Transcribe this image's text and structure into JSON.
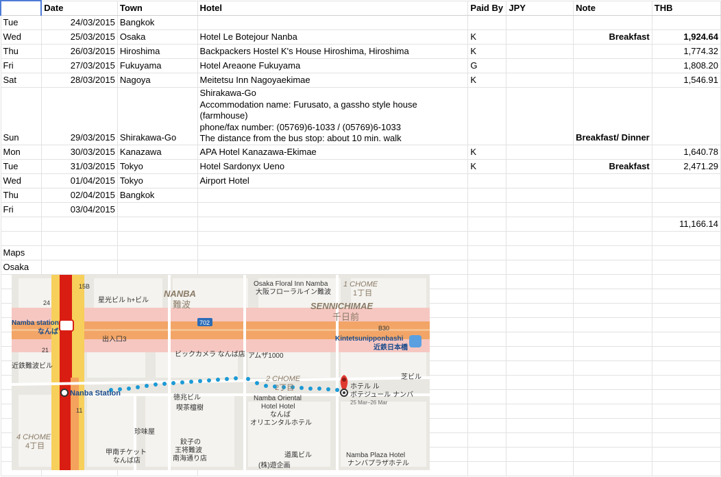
{
  "headers": [
    "",
    "Date",
    "Town",
    "Hotel",
    "Paid By",
    "JPY",
    "Note",
    "THB"
  ],
  "rows": [
    [
      "Tue",
      "24/03/2015",
      "Bangkok",
      "",
      "",
      "",
      "",
      ""
    ],
    [
      "Wed",
      "25/03/2015",
      "Osaka",
      "Hotel Le Botejour Nanba",
      "K",
      "",
      "Breakfast",
      "1,924.64"
    ],
    [
      "Thu",
      "26/03/2015",
      "Hiroshima",
      "Backpackers Hostel K's House Hiroshima, Hiroshima",
      "K",
      "",
      "",
      "1,774.32"
    ],
    [
      "Fri",
      "27/03/2015",
      "Fukuyama",
      "Hotel Areaone Fukuyama",
      "G",
      "",
      "",
      "1,808.20"
    ],
    [
      "Sat",
      "28/03/2015",
      "Nagoya",
      "Meitetsu Inn Nagoyaekimae",
      "K",
      "",
      "",
      "1,546.91"
    ],
    [
      "Sun",
      "29/03/2015",
      "Shirakawa-Go",
      "",
      "",
      "",
      "Breakfast/ Dinner",
      ""
    ],
    [
      "Mon",
      "30/03/2015",
      "Kanazawa",
      "APA Hotel Kanazawa-Ekimae",
      "K",
      "",
      "",
      "1,640.78"
    ],
    [
      "Tue",
      "31/03/2015",
      "Tokyo",
      "Hotel Sardonyx Ueno",
      "K",
      "",
      "Breakfast",
      "2,471.29"
    ],
    [
      "Wed",
      "01/04/2015",
      "Tokyo",
      "Airport Hotel",
      "",
      "",
      "",
      ""
    ],
    [
      "Thu",
      "02/04/2015",
      "Bangkok",
      "",
      "",
      "",
      "",
      ""
    ],
    [
      "Fri",
      "03/04/2015",
      "",
      "",
      "",
      "",
      "",
      ""
    ]
  ],
  "shirakawa_hotel_lines": [
    "Shirakawa-Go",
    "Accommodation name: Furusato, a gassho style house (farmhouse)",
    "phone/fax number:    (05769)6-1033 / (05769)6-1033",
    "The distance from the bus stop: about 10 min. walk"
  ],
  "total_thb": "11,166.14",
  "maps_label": "Maps",
  "osaka_label": "Osaka",
  "map": {
    "labels": {
      "osaka_floral": "Osaka Floral Inn Namba",
      "osaka_floral_jp": "大阪フローラルイン難波",
      "one_chome": "1 CHOME",
      "one_chome_jp": "1丁目",
      "namba": "NANBA",
      "namba_jp": "難波",
      "sennichimae": "SENNICHIMAE",
      "sennichimae_jp": "千日前",
      "namba_station_top": "Namba station",
      "namba_kana": "なんば",
      "route_702": "702",
      "kintetsu": "Kintetsunipponbashi",
      "kintetsu_jp": "近鉄日本橋",
      "b30": "B30",
      "exit3": "出入口3",
      "bic_camera": "ビックカメラ なんば店",
      "amusu": "アムザ1000",
      "two_chome": "2 CHOME",
      "two_chome_jp": "2丁目",
      "namba_station": "Nanba Station",
      "hotel_pin_1": "ホテル ル",
      "hotel_pin_2": "ボテジュール ナンバ",
      "hotel_pin_dates": "25 Mar–26 Mar",
      "namba_oriental": "Namba Oriental",
      "hotel_hotel": "Hotel Hotel",
      "namba_kana2": "なんば",
      "oriental_jp": "オリエンタルホテル",
      "four_chome": "4 CHOME",
      "four_chome_jp": "4丁目",
      "kinkan": "珍味屋",
      "konan": "甲南チケット",
      "konan2": "なんば店",
      "gyoza": "餃子の",
      "gyoza2": "王将難波",
      "gyoza3": "南海通り店",
      "dofu": "道風ビル",
      "yugen": "(株)遊企画",
      "namba_plaza": "Namba Plaza Hotel",
      "namba_plaza_jp": "ナンバプラザホテル",
      "seikobiru": "星光ビル h+ビル",
      "kitsuten": "喫茶檀樹",
      "tokucho": "徳兆ビル",
      "kintetsunamba": "近鉄難波ビル",
      "shiba": "芝ビル",
      "l15b": "15B",
      "l24": "24",
      "l21": "21",
      "l11": "11"
    }
  }
}
